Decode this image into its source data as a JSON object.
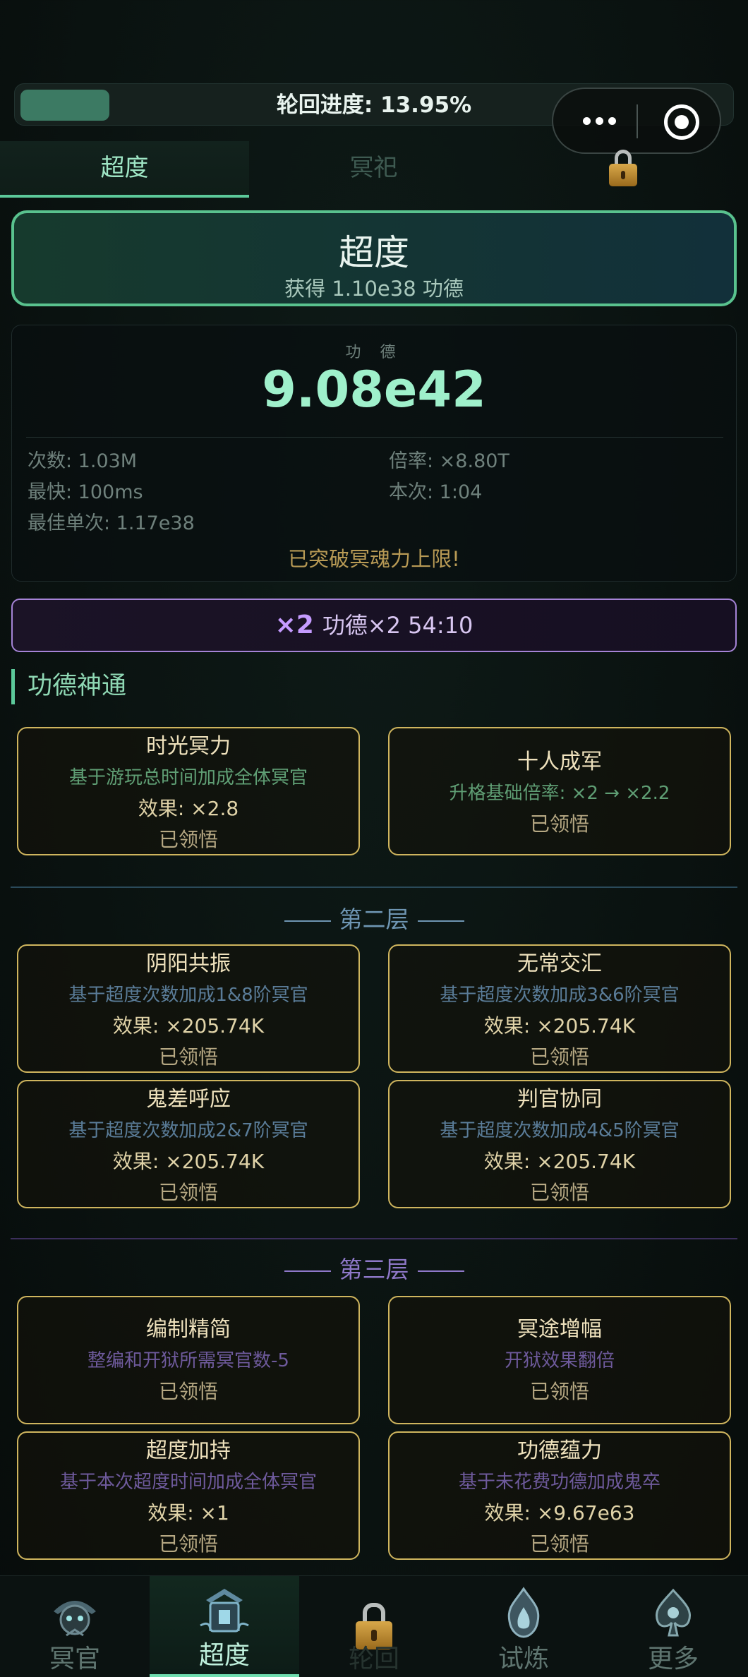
{
  "progress": {
    "label": "轮回进度: 13.95%",
    "value_percent": 13.95
  },
  "tabs": [
    {
      "label": "超度",
      "active": true
    },
    {
      "label": "冥祀",
      "active": false
    },
    {
      "label": "",
      "locked": true,
      "icon": "lock-icon"
    }
  ],
  "chaodu_button": {
    "title": "超度",
    "subtitle": "获得 1.10e38 功德"
  },
  "stats": {
    "label": "功 德",
    "value": "9.08e42",
    "count": "次数: 1.03M",
    "multiplier": "倍率: ×8.80T",
    "fastest": "最快: 100ms",
    "this_time": "本次: 1:04",
    "best_single": "最佳单次: 1.17e38",
    "limit_notice": "已突破冥魂力上限!"
  },
  "bonus": {
    "badge": "×2",
    "text": "功德×2 54:10"
  },
  "section_title": "功德神通",
  "layer1": [
    {
      "title": "时光冥力",
      "desc": "基于游玩总时间加成全体冥官",
      "effect": "效果: ×2.8",
      "status": "已领悟"
    },
    {
      "title": "十人成军",
      "desc": "升格基础倍率: ×2 → ×2.2",
      "status": "已领悟"
    }
  ],
  "layer2_title": "第二层",
  "layer2": [
    {
      "title": "阴阳共振",
      "desc": "基于超度次数加成1&8阶冥官",
      "effect": "效果: ×205.74K",
      "status": "已领悟"
    },
    {
      "title": "无常交汇",
      "desc": "基于超度次数加成3&6阶冥官",
      "effect": "效果: ×205.74K",
      "status": "已领悟"
    },
    {
      "title": "鬼差呼应",
      "desc": "基于超度次数加成2&7阶冥官",
      "effect": "效果: ×205.74K",
      "status": "已领悟"
    },
    {
      "title": "判官协同",
      "desc": "基于超度次数加成4&5阶冥官",
      "effect": "效果: ×205.74K",
      "status": "已领悟"
    }
  ],
  "layer3_title": "第三层",
  "layer3": [
    {
      "title": "编制精简",
      "desc": "整编和开狱所需冥官数-5",
      "status": "已领悟"
    },
    {
      "title": "冥途增幅",
      "desc": "开狱效果翻倍",
      "status": "已领悟"
    },
    {
      "title": "超度加持",
      "desc": "基于本次超度时间加成全体冥官",
      "effect": "效果: ×1",
      "status": "已领悟"
    },
    {
      "title": "功德蕴力",
      "desc": "基于未花费功德加成鬼卒",
      "effect": "效果: ×9.67e63",
      "status": "已领悟"
    }
  ],
  "bottom_nav": [
    {
      "label": "冥官",
      "icon": "ghost-officer-icon",
      "active": false
    },
    {
      "label": "超度",
      "icon": "temple-icon",
      "active": true
    },
    {
      "label": "轮回",
      "icon": "lock-icon",
      "active": false,
      "locked": true
    },
    {
      "label": "试炼",
      "icon": "flame-icon",
      "active": false
    },
    {
      "label": "更多",
      "icon": "spade-icon",
      "active": false
    }
  ],
  "colors": {
    "accent": "#5cc99a",
    "gold_border": "#cfb55e",
    "purple": "#a583d6"
  }
}
